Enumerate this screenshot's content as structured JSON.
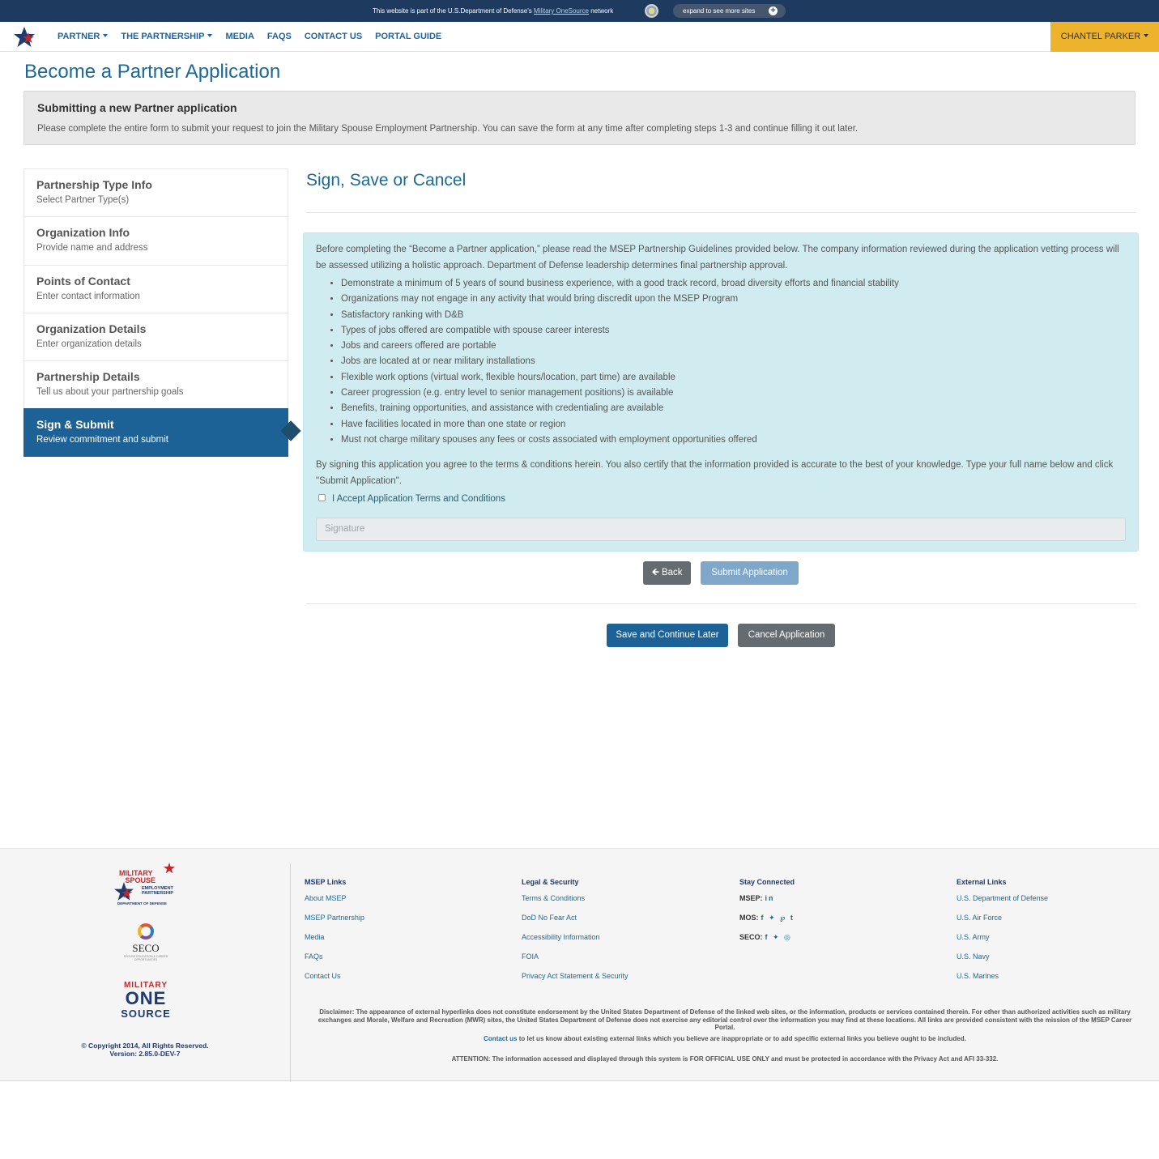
{
  "banner": {
    "message_before": "This website is part of the U.S.Department of Defense's",
    "link": "Military OneSource",
    "message_after": "network",
    "expand_label": "expand to see more sites",
    "expand_icon": "plus-icon"
  },
  "nav": {
    "items": [
      {
        "label": "PARTNER",
        "dropdown": true
      },
      {
        "label": "THE PARTNERSHIP",
        "dropdown": true
      },
      {
        "label": "MEDIA",
        "dropdown": false
      },
      {
        "label": "FAQS",
        "dropdown": false
      },
      {
        "label": "CONTACT US",
        "dropdown": false
      },
      {
        "label": "PORTAL GUIDE",
        "dropdown": false
      }
    ],
    "user_label": "CHANTEL PARKER",
    "accent_color": "#eeb32c",
    "brand_color": "#1d6296"
  },
  "page": {
    "title": "Become a Partner Application",
    "intro_heading": "Submitting a new Partner application",
    "intro_text": "Please complete the entire form to submit your request to join the Military Spouse Employment Partnership. You can save the form at any time after completing steps 1-3 and continue filling it out later."
  },
  "steps": [
    {
      "title": "Partnership Type Info",
      "subtitle": "Select Partner Type(s)",
      "active": false
    },
    {
      "title": "Organization Info",
      "subtitle": "Provide name and address",
      "active": false
    },
    {
      "title": "Points of Contact",
      "subtitle": "Enter contact information",
      "active": false
    },
    {
      "title": "Organization Details",
      "subtitle": "Enter organization details",
      "active": false
    },
    {
      "title": "Partnership Details",
      "subtitle": "Tell us about your partnership goals",
      "active": false
    },
    {
      "title": "Sign & Submit",
      "subtitle": "Review commitment and submit",
      "active": true
    }
  ],
  "main": {
    "section_title": "Sign, Save or Cancel",
    "guidelines_intro": "Before completing the “Become a Partner application,” please read the MSEP Partnership Guidelines provided below. The company information reviewed during the application vetting process will be assessed utilizing a holistic approach. Department of Defense leadership determines final partnership approval.",
    "guidelines": [
      "Demonstrate a minimum of 5 years of sound business experience, with a good track record, broad diversity efforts and financial stability",
      "Organizations may not engage in any activity that would bring discredit upon the MSEP Program",
      "Satisfactory ranking with D&B",
      "Types of jobs offered are compatible with spouse career interests",
      "Jobs and careers offered are portable",
      "Jobs are located at or near military installations",
      "Flexible work options (virtual work, flexible hours/location, part time) are available",
      "Career progression (e.g. entry level to senior management positions) is available",
      "Benefits, training opportunities, and assistance with credentialing are available",
      "Have facilities located in more than one state or region",
      "Must not charge military spouses any fees or costs associated with employment opportunities offered"
    ],
    "agreement_text": "By signing this application you agree to the terms & conditions herein. You also certify that the information provided is accurate to the best of your knowledge. Type your full name below and click \"Submit Application\".",
    "accept_label": "I Accept Application Terms and Conditions",
    "accept_checked": false,
    "signature_placeholder": "Signature",
    "signature_value": "",
    "back_label": "Back",
    "submit_label": "Submit Application",
    "save_label": "Save and Continue Later",
    "cancel_label": "Cancel Application"
  },
  "footer": {
    "logos": {
      "msep_line1": "MILITARY",
      "msep_line2": "SPOUSE",
      "msep_line3": "EMPLOYMENT",
      "msep_line4": "PARTNERSHIP",
      "msep_line5": "DEPARTMENT OF DEFENSE",
      "seco_name": "SECO",
      "seco_sub": "SPOUSE EDUCATION & CAREER OPPORTUNITIES",
      "mos_line1": "MILITARY",
      "mos_line2": "ONE",
      "mos_line3": "SOURCE"
    },
    "copyright": "© Copyright 2014, All Rights Reserved.",
    "version": "Version: 2.85.0-DEV-7",
    "columns": [
      {
        "heading": "MSEP Links",
        "items": [
          "About MSEP",
          "MSEP Partnership",
          "Media",
          "FAQs",
          "Contact Us"
        ]
      },
      {
        "heading": "Legal & Security",
        "items": [
          "Terms & Conditions",
          "DoD No Fear Act",
          "Accessibility Information",
          "FOIA",
          "Privacy Act Statement & Security"
        ]
      },
      {
        "heading": "Stay Connected",
        "items": []
      },
      {
        "heading": "External Links",
        "items": [
          "U.S. Department of Defense",
          "U.S. Air Force",
          "U.S. Army",
          "U.S. Navy",
          "U.S. Marines"
        ]
      }
    ],
    "social": [
      {
        "label": "MSEP:",
        "icons": [
          "linkedin-icon"
        ],
        "glyphs": "in"
      },
      {
        "label": "MOS:",
        "icons": [
          "facebook-icon",
          "twitter-icon",
          "pinterest-icon",
          "tumblr-icon"
        ],
        "glyphs": "f ✦ ℘ t"
      },
      {
        "label": "SECO:",
        "icons": [
          "facebook-icon",
          "twitter-icon",
          "instagram-icon"
        ],
        "glyphs": "f ✦ ◎"
      }
    ],
    "disclaimer": "Disclaimer: The appearance of external hyperlinks does not constitute endorsement by the United States Department of Defense of the linked web sites, or the information, products or services contained therein. For other than authorized activities such as military exchanges and Morale, Welfare and Recreation (MWR) sites, the United States Department of Defense does not exercise any editorial control over the information you may find at these locations. All links are provided consistent with the mission of the MSEP Career Portal.",
    "contact_link": "Contact us",
    "contact_text": "to let us know about existing external links which you believe are inappropriate or to add specific external links you believe ought to be included.",
    "attention": "ATTENTION: The information accessed and displayed through this system is FOR OFFICIAL USE ONLY and must be protected in accordance with the Privacy Act and AFI 33-332."
  }
}
